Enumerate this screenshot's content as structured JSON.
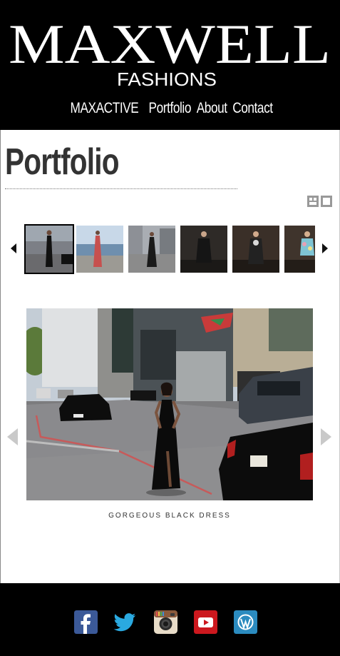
{
  "brand": {
    "name": "MAXWELL",
    "tagline": "FASHIONS"
  },
  "nav": {
    "items": [
      {
        "label": "MAXACTIVE"
      },
      {
        "label": "Portfolio"
      },
      {
        "label": "About"
      },
      {
        "label": "Contact"
      }
    ]
  },
  "page": {
    "title": "Portfolio"
  },
  "gallery": {
    "caption": "GORGEOUS BLACK DRESS",
    "active_index": 0,
    "thumbnail_count": 6
  },
  "social": {
    "icons": [
      "facebook-icon",
      "twitter-icon",
      "instagram-icon",
      "youtube-icon",
      "wordpress-icon"
    ]
  },
  "colors": {
    "header_bg": "#000000",
    "footer_bg": "#000000",
    "facebook": "#3b5998",
    "twitter": "#2aa9e0",
    "youtube": "#cc181e",
    "wordpress": "#2b8bbf"
  }
}
